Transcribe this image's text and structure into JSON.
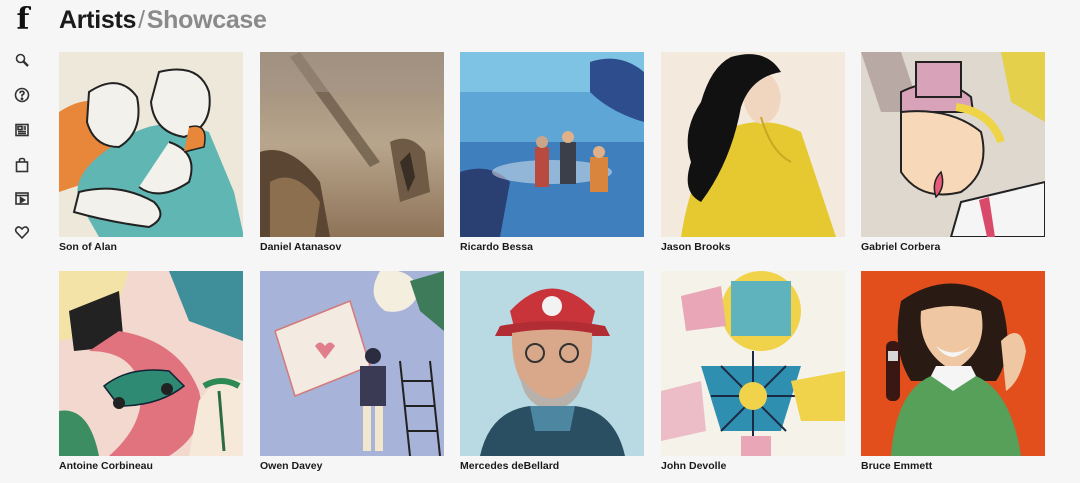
{
  "header": {
    "logo": "f",
    "section": "Artists",
    "separator": "/",
    "subsection": "Showcase"
  },
  "sidebar": {
    "icons": [
      "search-icon",
      "help-icon",
      "news-icon",
      "shop-icon",
      "video-icon",
      "heart-icon"
    ]
  },
  "artists": [
    {
      "name": "Son of Alan"
    },
    {
      "name": "Daniel Atanasov"
    },
    {
      "name": "Ricardo Bessa"
    },
    {
      "name": "Jason Brooks"
    },
    {
      "name": "Gabriel Corbera"
    },
    {
      "name": "Antoine Corbineau"
    },
    {
      "name": "Owen Davey"
    },
    {
      "name": "Mercedes deBellard"
    },
    {
      "name": "John Devolle"
    },
    {
      "name": "Bruce Emmett"
    }
  ]
}
